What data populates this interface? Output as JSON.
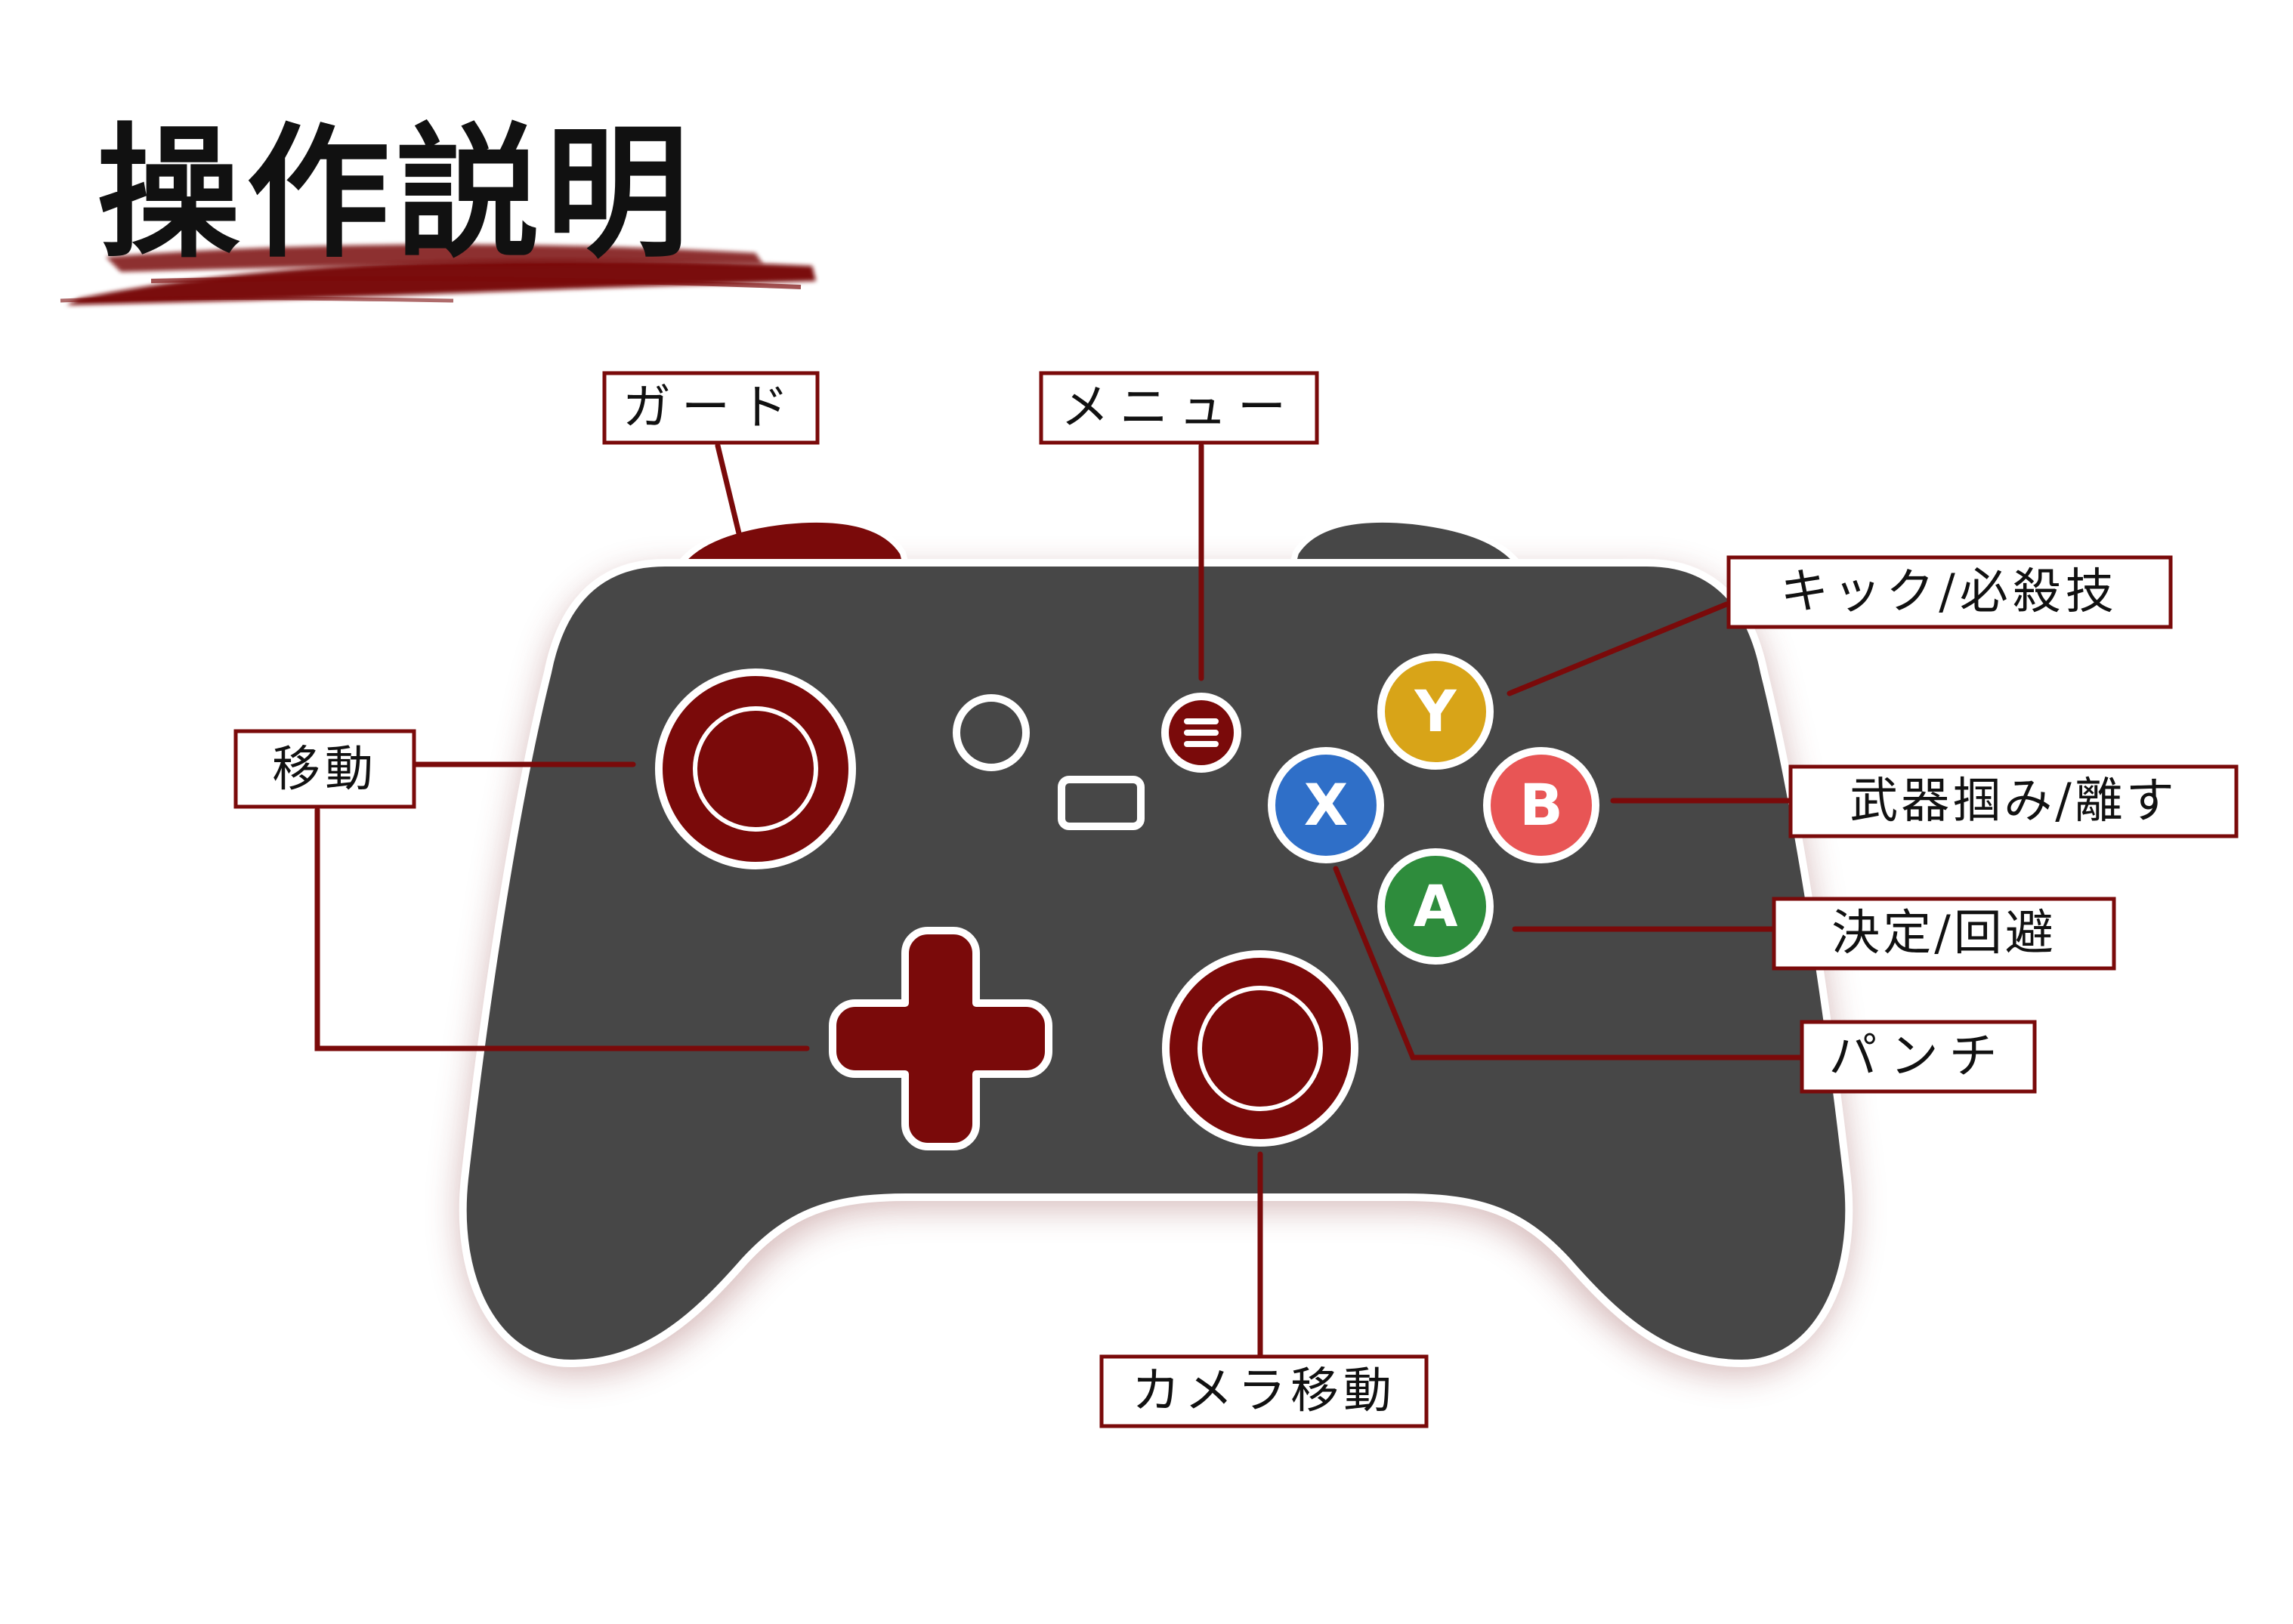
{
  "title": "操作説明",
  "colors": {
    "accent": "#7a0a0a",
    "body": "#474747",
    "outline": "#ffffff",
    "button_y": "#d8a418",
    "button_b": "#e85555",
    "button_a": "#2e8c3c",
    "button_x": "#2f6fc8"
  },
  "buttons": {
    "y": "Y",
    "b": "B",
    "a": "A",
    "x": "X"
  },
  "icons": {
    "menu": "menu-icon",
    "view": "view-icon",
    "share": "share-icon"
  },
  "labels": {
    "guard": "ガード",
    "menu": "メニュー",
    "kick": "キック/必殺技",
    "move": "移動",
    "weapon": "武器掴み/離す",
    "confirm": "決定/回避",
    "punch": "パンチ",
    "camera": "カメラ移動"
  }
}
